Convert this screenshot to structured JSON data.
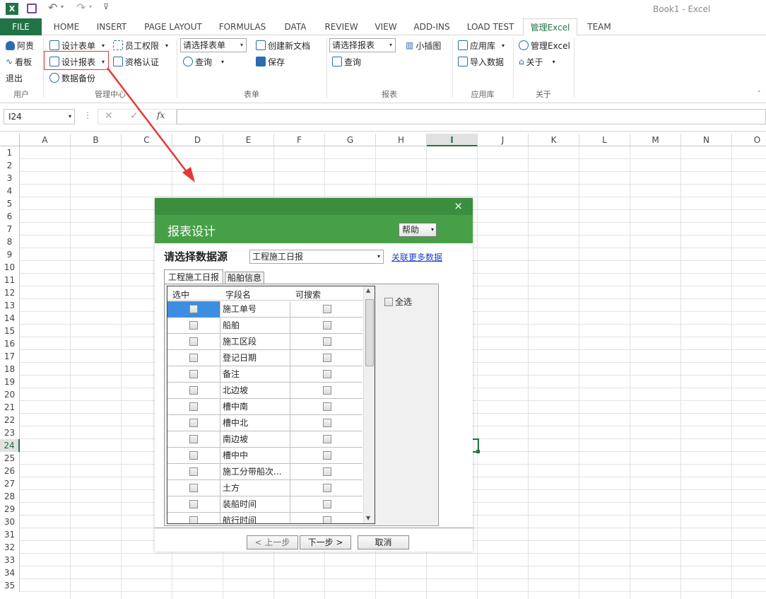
{
  "window": {
    "title": "Book1 - Excel"
  },
  "ribbon_tabs": [
    "FILE",
    "HOME",
    "INSERT",
    "PAGE LAYOUT",
    "FORMULAS",
    "DATA",
    "REVIEW",
    "VIEW",
    "ADD-INS",
    "LOAD TEST",
    "管理Excel",
    "TEAM"
  ],
  "ribbon": {
    "user": {
      "name": "阿贵",
      "board": "看板",
      "logout": "退出",
      "group": "用户"
    },
    "mgmt": {
      "design_form": "设计表单",
      "design_report": "设计报表",
      "backup": "数据备份",
      "permission": "员工权限",
      "cert": "资格认证",
      "group": "管理中心"
    },
    "form": {
      "select_placeholder": "请选择表单",
      "query": "查询",
      "new_doc": "创建新文档",
      "save": "保存",
      "group": "表单"
    },
    "report": {
      "select_placeholder": "请选择报表",
      "query": "查询",
      "chart": "小插图",
      "group": "报表"
    },
    "apps": {
      "library": "应用库",
      "import": "导入数据",
      "group": "应用库"
    },
    "about": {
      "manage": "管理Excel",
      "about": "关于",
      "group": "关于"
    }
  },
  "formula_bar": {
    "name_box": "I24",
    "fx": "fx",
    "value": ""
  },
  "columns": [
    "A",
    "B",
    "C",
    "D",
    "E",
    "F",
    "G",
    "H",
    "I",
    "J",
    "K",
    "L",
    "M",
    "N",
    "O"
  ],
  "rows": [
    "1",
    "2",
    "3",
    "4",
    "5",
    "6",
    "7",
    "8",
    "9",
    "10",
    "11",
    "12",
    "13",
    "14",
    "15",
    "16",
    "17",
    "18",
    "19",
    "20",
    "21",
    "22",
    "23",
    "24",
    "25",
    "26",
    "27",
    "28",
    "29",
    "30",
    "31",
    "32",
    "33",
    "34",
    "35"
  ],
  "dialog": {
    "title": "报表设计",
    "help": "帮助",
    "source_label": "请选择数据源",
    "source_value": "工程施工日报",
    "link": "关联更多数据",
    "tabs": [
      "工程施工日报",
      "船舶信息"
    ],
    "table_headers": [
      "选中",
      "字段名",
      "可搜索"
    ],
    "fields": [
      "施工单号",
      "船舶",
      "施工区段",
      "登记日期",
      "备注",
      "北边坡",
      "槽中南",
      "槽中北",
      "南边坡",
      "槽中中",
      "施工分带船次...",
      "土方",
      "装船时间",
      "航行时间"
    ],
    "select_all": "全选",
    "prev": "< 上一步",
    "next": "下一步 >",
    "cancel": "取消",
    "close": "×"
  },
  "colors": {
    "excel_green": "#217346",
    "dialog_green": "#47a047",
    "annotation_red": "#e53935"
  }
}
